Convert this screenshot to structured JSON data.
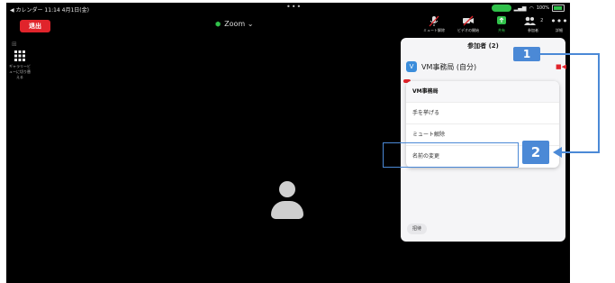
{
  "statusbar": {
    "left": "◀ カレンダー  11:14  4月1日(金)",
    "dots": "•••",
    "battery_text": "100%"
  },
  "toolbar": {
    "leave_label": "退出",
    "meeting_title": "Zoom ⌄",
    "buttons": [
      {
        "icon": "🎙",
        "label": "ミュート解除"
      },
      {
        "icon": "▰",
        "label": "ビデオの開始"
      },
      {
        "icon": "⬆",
        "label": "共有"
      },
      {
        "icon": "👥",
        "label": "参加者"
      },
      {
        "icon": "•••",
        "label": "詳細"
      }
    ],
    "participants_count": "2"
  },
  "left_view": {
    "gallery_label": "ギャラリービューに切り替える"
  },
  "panel": {
    "header": "参加者 (2)",
    "participant_badge": "V",
    "participant_name": "VM事務局 (自分)",
    "invite_label": "招待"
  },
  "menu": {
    "title": "VM事務局",
    "items": [
      "手を挙げる",
      "ミュート解除",
      "名前の変更"
    ]
  },
  "annotations": {
    "callout_1": "1",
    "callout_2": "2",
    "accent": "#4b89d6"
  }
}
